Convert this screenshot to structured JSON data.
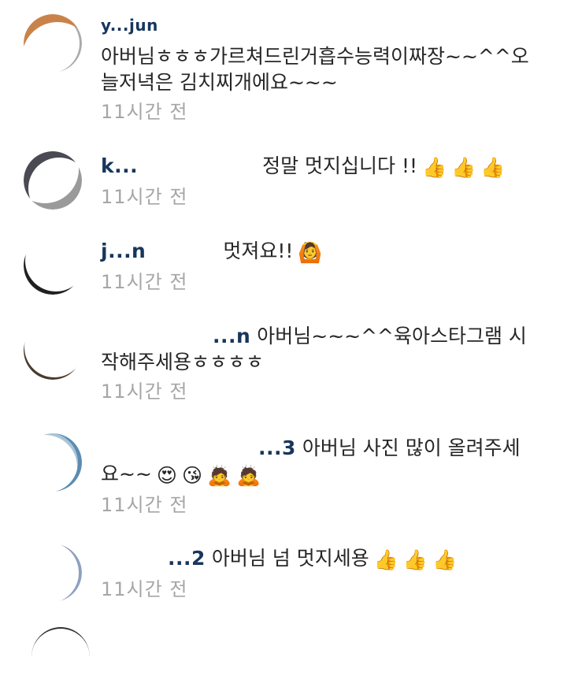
{
  "comments": [
    {
      "username": "y...jun",
      "text": "아버님ㅎㅎㅎ가르쳐드린거흡수능력이짜장~~^^오늘저녁은 김치찌개에요~~~",
      "time": "11시간 전",
      "emojis": [],
      "avatar_color": "#c9834a"
    },
    {
      "username": "k...",
      "text": "정말 멋지십니다 !!",
      "time": "11시간 전",
      "emojis": [
        "👍",
        "👍",
        "👍"
      ],
      "avatar_color": "#4a4a52"
    },
    {
      "username": "j...n",
      "text": "멋져요!!",
      "time": "11시간 전",
      "emojis": [
        "🙆"
      ],
      "avatar_color": "#202020"
    },
    {
      "username": "...n",
      "text": "아버님~~~^^육아스타그램 시작해주세용ㅎㅎㅎㅎ",
      "time": "11시간 전",
      "emojis": [],
      "avatar_color": "#4a3a2a"
    },
    {
      "username": "...3",
      "text": "아버님 사진 많이 올려주세요~~",
      "time": "11시간 전",
      "emojis": [
        "😍",
        "😘",
        "🙇",
        "🙇"
      ],
      "avatar_color": "#5d8bb0"
    },
    {
      "username": "...2",
      "text": "아버님 넘 멋지세용",
      "time": "11시간 전",
      "emojis": [
        "👍",
        "👍",
        "👍"
      ],
      "avatar_color": "#8fa0c0"
    }
  ]
}
